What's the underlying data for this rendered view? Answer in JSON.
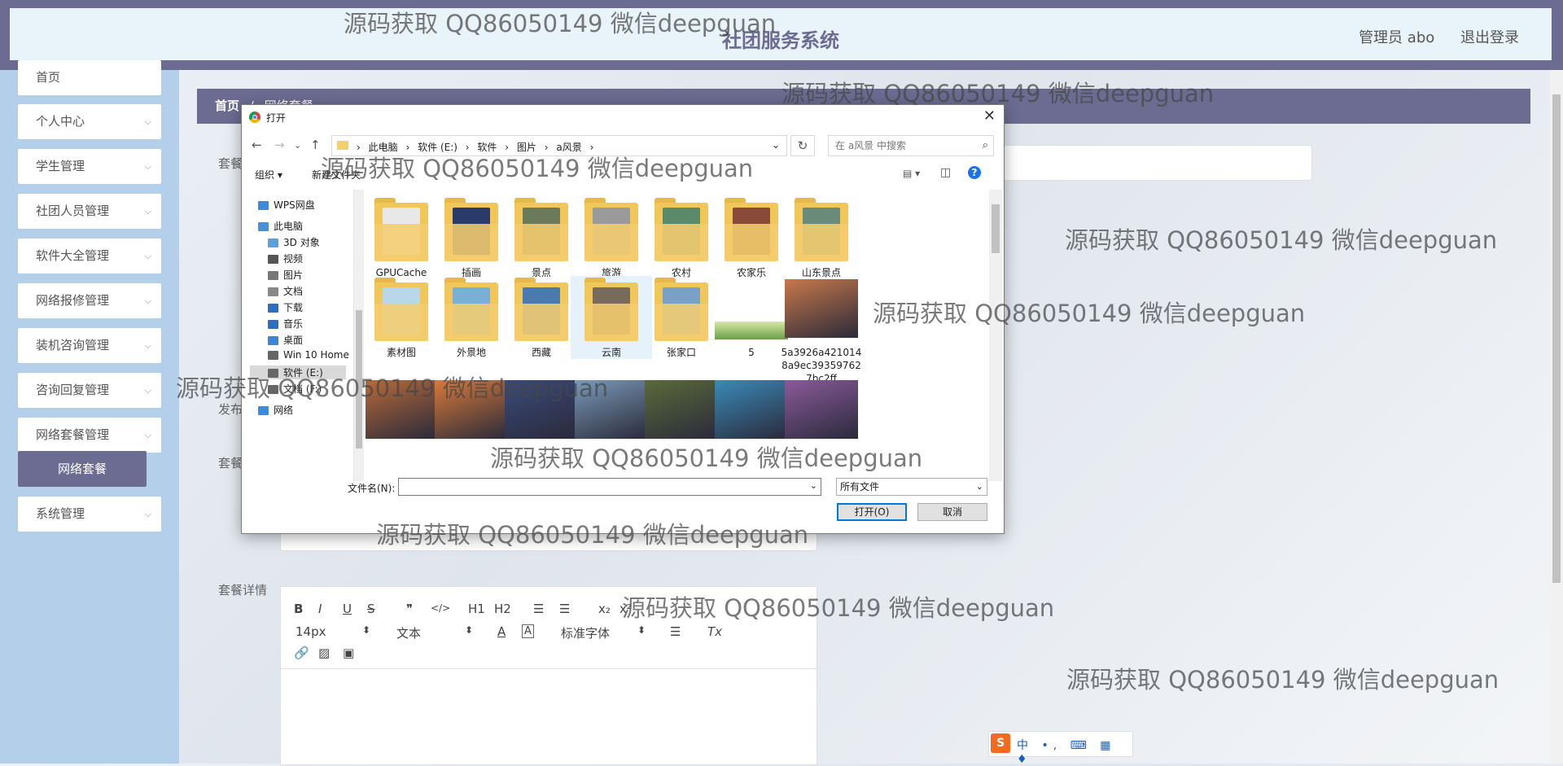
{
  "header": {
    "title": "社团服务系统",
    "user": "管理员 abo",
    "logout": "退出登录"
  },
  "sidebar": {
    "items": [
      {
        "label": "首页",
        "chevron": ""
      },
      {
        "label": "个人中心",
        "chevron": "⌵"
      },
      {
        "label": "学生管理",
        "chevron": "⌵"
      },
      {
        "label": "社团人员管理",
        "chevron": "⌵"
      },
      {
        "label": "软件大全管理",
        "chevron": "⌵"
      },
      {
        "label": "网络报修管理",
        "chevron": "⌵"
      },
      {
        "label": "装机咨询管理",
        "chevron": "⌵"
      },
      {
        "label": "咨询回复管理",
        "chevron": "⌵"
      },
      {
        "label": "网络套餐管理",
        "chevron": "⌵"
      },
      {
        "label": "系统管理",
        "chevron": "⌵"
      }
    ],
    "active_sub": "网络套餐"
  },
  "breadcrumb": {
    "home": "首页",
    "separator": "/",
    "current": "网络套餐"
  },
  "form": {
    "label_name": "套餐",
    "label_publish": "发布",
    "label_price": "套餐",
    "label_detail": "套餐详情"
  },
  "editor": {
    "bold": "B",
    "italic": "I",
    "underline": "U",
    "strike": "S",
    "quote": "❞",
    "code": "</>",
    "h1": "H1",
    "h2": "H2",
    "ordered_list": "☰",
    "bullet_list": "☰",
    "subscript": "x₂",
    "superscript": "x²",
    "font_size": "14px",
    "text_type": "文本",
    "font_family": "标准字体",
    "align": "☰",
    "clear": "Tx",
    "stepper": "⬍"
  },
  "dialog": {
    "title": "打开",
    "close": "✕",
    "back": "←",
    "forward": "→",
    "recent": "⌄",
    "up": "↑",
    "path": [
      "此电脑",
      "软件 (E:)",
      "软件",
      "图片",
      "a风景"
    ],
    "path_sep": "›",
    "path_dropdown": "⌄",
    "refresh": "↻",
    "search_placeholder": "在 a风景 中搜索",
    "search_icon": "⌕",
    "organize": "组织 ▾",
    "new_folder": "新建文件夹",
    "view_icon": "▤ ▾",
    "pane_icon": "◫",
    "help": "?",
    "tree": [
      {
        "label": "WPS网盘",
        "icon": "cloud-icon",
        "color": "#3c8ae0"
      },
      {
        "label": "此电脑",
        "icon": "computer-icon",
        "color": "#4a90d9"
      },
      {
        "label": "3D 对象",
        "icon": "cube-icon",
        "color": "#5aa0e0"
      },
      {
        "label": "视频",
        "icon": "video-icon",
        "color": "#555"
      },
      {
        "label": "图片",
        "icon": "picture-icon",
        "color": "#777"
      },
      {
        "label": "文档",
        "icon": "document-icon",
        "color": "#888"
      },
      {
        "label": "下载",
        "icon": "download-icon",
        "color": "#2c6fc1"
      },
      {
        "label": "音乐",
        "icon": "music-icon",
        "color": "#2c6fc1"
      },
      {
        "label": "桌面",
        "icon": "desktop-icon",
        "color": "#3a85d8"
      },
      {
        "label": "Win 10 Home",
        "icon": "drive-icon",
        "color": "#666"
      },
      {
        "label": "软件 (E:)",
        "icon": "drive-icon",
        "color": "#666"
      },
      {
        "label": "文档 (F:)",
        "icon": "drive-icon",
        "color": "#666"
      },
      {
        "label": "网络",
        "icon": "network-icon",
        "color": "#3c8ae0"
      }
    ],
    "files": [
      {
        "name": "GPUCache",
        "kind": "folder",
        "pic": "#e8e8e8"
      },
      {
        "name": "插画",
        "kind": "folder",
        "pic": "#2a3a6a"
      },
      {
        "name": "景点",
        "kind": "folder",
        "pic": "#6a7a5a"
      },
      {
        "name": "旅游",
        "kind": "folder",
        "pic": "#9a9a9a"
      },
      {
        "name": "农村",
        "kind": "folder",
        "pic": "#5a8a6a"
      },
      {
        "name": "农家乐",
        "kind": "folder",
        "pic": "#8a4a3a"
      },
      {
        "name": "山东景点",
        "kind": "folder",
        "pic": "#6a8a7a"
      },
      {
        "name": "素材图",
        "kind": "folder",
        "pic": "#b8d8e8"
      },
      {
        "name": "外景地",
        "kind": "folder",
        "pic": "#7ab0d8"
      },
      {
        "name": "西藏",
        "kind": "folder",
        "pic": "#4a7ab0"
      },
      {
        "name": "云南",
        "kind": "folder",
        "pic": "#7a6a5a"
      },
      {
        "name": "张家口",
        "kind": "folder",
        "pic": "#7aa0c8"
      },
      {
        "name": "5",
        "kind": "image",
        "pic": "#6aa04a"
      },
      {
        "name": "5a3926a4210148a9ec393597627bc2ff",
        "kind": "image",
        "pic": "#c8784a"
      },
      {
        "name": "",
        "kind": "image",
        "pic": "#b86a3a"
      },
      {
        "name": "",
        "kind": "image",
        "pic": "#d87a3a"
      },
      {
        "name": "",
        "kind": "image",
        "pic": "#3a4a7a"
      },
      {
        "name": "",
        "kind": "image",
        "pic": "#7a9ab8"
      },
      {
        "name": "",
        "kind": "image",
        "pic": "#5a6a3a"
      },
      {
        "name": "",
        "kind": "image",
        "pic": "#3a8ab8"
      },
      {
        "name": "",
        "kind": "image",
        "pic": "#8a5a9a"
      }
    ],
    "filename_label": "文件名(N):",
    "filename_value": "",
    "filetype": "所有文件",
    "open_button": "打开(O)",
    "cancel_button": "取消"
  },
  "ime": {
    "logo": "S",
    "text": "中 •, ⌨ ▦ ♦"
  },
  "watermark": "源码获取 QQ86050149 微信deepguan"
}
